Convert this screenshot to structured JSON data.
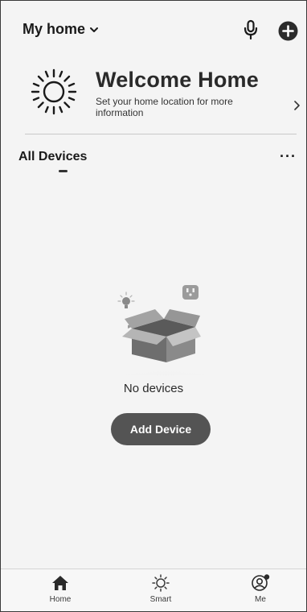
{
  "header": {
    "home_name": "My home",
    "icons": [
      "chevron-down-icon",
      "microphone-icon",
      "add-circle-icon"
    ]
  },
  "welcome": {
    "title": "Welcome Home",
    "subtitle": "Set your home location for more information",
    "icons": [
      "sun-icon",
      "chevron-right-icon"
    ]
  },
  "devices_tab": {
    "label": "All Devices",
    "more_label": "···"
  },
  "empty_state": {
    "message": "No devices",
    "button_label": "Add Device",
    "illustration": [
      "open-box-icon",
      "bulb-icon",
      "socket-icon"
    ]
  },
  "bottom_nav": {
    "items": [
      {
        "label": "Home",
        "icon": "home-icon",
        "active": true
      },
      {
        "label": "Smart",
        "icon": "sun-icon",
        "active": false
      },
      {
        "label": "Me",
        "icon": "user-icon",
        "active": false
      }
    ]
  },
  "colors": {
    "background": "#f4f4f4",
    "button": "#545454",
    "text": "#1c1c1c"
  }
}
